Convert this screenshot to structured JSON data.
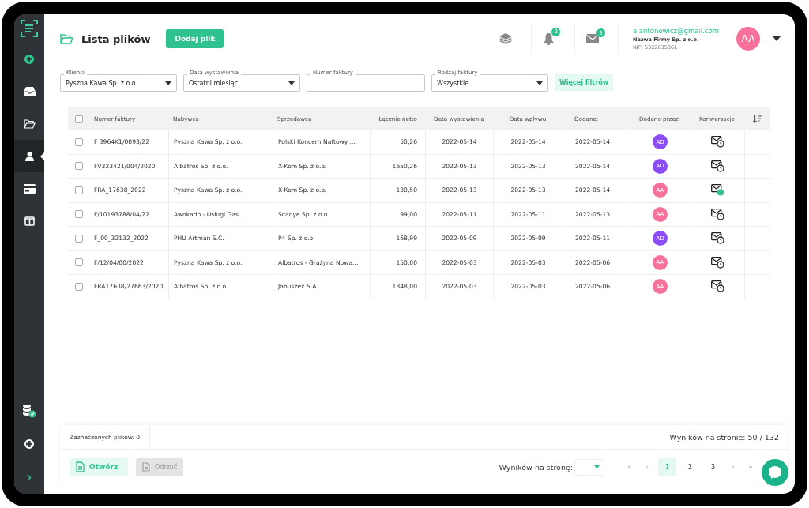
{
  "sidebar": {
    "items": [
      {
        "selected": false
      },
      {
        "selected": false
      },
      {
        "selected": false
      },
      {
        "selected": true
      },
      {
        "selected": false
      },
      {
        "selected": false
      }
    ]
  },
  "header": {
    "title": "Lista plików",
    "add_button": "Dodaj plik",
    "notifications_badge": "2",
    "messages_badge": "3",
    "user": {
      "email": "a.antonowicz@gmail.com",
      "company": "Nazwa Firmy Sp. z o.o.",
      "nip": "NIP: 5322635361",
      "initials": "AA"
    }
  },
  "filters": [
    {
      "kind": "select",
      "label": "Klienci",
      "value": "Pyszna Kawa Sp. z o.o."
    },
    {
      "kind": "select",
      "label": "Data wystawienia",
      "value": "Ostatni miesiąc"
    },
    {
      "kind": "text",
      "label": "Numer faktury"
    },
    {
      "kind": "select",
      "label": "Rodzaj faktury",
      "value": "Wszystkie"
    }
  ],
  "more_filters": "Więcej filtrów",
  "table": {
    "select_all_checked": false,
    "columns": [
      "Numer faktury",
      "Nabywca",
      "Sprzedawca",
      "Łącznie netto",
      "Data wystawienia",
      "Data wpływu",
      "Dodano:",
      "Dodano przez:",
      "Konwersacje"
    ],
    "rows": [
      {
        "checked": false,
        "number": "F 3964K1/0093/22",
        "buyer": "Pyszna Kawa Sp. z o.o.",
        "seller": "Polski Koncern Naftowy ...",
        "net": "50,26",
        "issued": "2022-05-14",
        "received": "2022-05-14",
        "added": "2022-05-14",
        "added_by": {
          "initials": "AD",
          "color": "#8b4cf6"
        },
        "conversation": {
          "kind": "pending"
        }
      },
      {
        "checked": false,
        "number": "FV323421/004/2020",
        "buyer": "Albatros Sp. z o.o.",
        "seller": "X-Kom Sp. z o.o.",
        "net": "1650,26",
        "issued": "2022-05-13",
        "received": "2022-05-13",
        "added": "2022-05-14",
        "added_by": {
          "initials": "AD",
          "color": "#8b4cf6"
        },
        "conversation": {
          "kind": "pending"
        }
      },
      {
        "checked": false,
        "number": "FRA_17638_2022",
        "buyer": "Pyszna Kawa Sp. z o.o.",
        "seller": "X-Kom Sp. z o.o.",
        "net": "130,50",
        "issued": "2022-05-13",
        "received": "2022-05-13",
        "added": "2022-05-14",
        "added_by": {
          "initials": "AA",
          "color": "#f7719a"
        },
        "conversation": {
          "kind": "new"
        }
      },
      {
        "checked": false,
        "number": "F/10193788/04/22",
        "buyer": "Awokado - Usługi Gas...",
        "seller": "Scanye Sp. z o.o.",
        "net": "99,00",
        "issued": "2022-05-11",
        "received": "2022-05-11",
        "added": "2022-05-13",
        "added_by": {
          "initials": "AA",
          "color": "#f7719a"
        },
        "conversation": {
          "kind": "pending"
        }
      },
      {
        "checked": false,
        "number": "F_00_32132_2022",
        "buyer": "PHU Artman S.C.",
        "seller": "P4 Sp. z o.o.",
        "net": "168,99",
        "issued": "2022-05-09",
        "received": "2022-05-09",
        "added": "2022-05-11",
        "added_by": {
          "initials": "AD",
          "color": "#8b4cf6"
        },
        "conversation": {
          "kind": "pending"
        }
      },
      {
        "checked": false,
        "number": "F/12/04/00/2022",
        "buyer": "Pyszna Kawa Sp. z o.o.",
        "seller": "Albatros - Grażyna Nowa...",
        "net": "150,00",
        "issued": "2022-05-03",
        "received": "2022-05-03",
        "added": "2022-05-06",
        "added_by": {
          "initials": "AA",
          "color": "#f7719a"
        },
        "conversation": {
          "kind": "pending"
        }
      },
      {
        "checked": false,
        "number": "FRA17638/27663/2020",
        "buyer": "Albatros Sp. z o.o.",
        "seller": "Januszex S.A.",
        "net": "1348,00",
        "issued": "2022-05-03",
        "received": "2022-05-03",
        "added": "2022-05-06",
        "added_by": {
          "initials": "AA",
          "color": "#f7719a"
        },
        "conversation": {
          "kind": "pending"
        }
      }
    ]
  },
  "footer": {
    "selected_count": "Zaznaczonych plików: 0",
    "results": "Wyników na stronie: 50 / 132",
    "open_button": {
      "label": "Otwórz",
      "disabled": false
    },
    "reject_button": {
      "label": "Odrzuć",
      "disabled": true
    },
    "per_page_label": "Wyników na stronę:",
    "pagination": [
      {
        "label": "«",
        "kind": "nav",
        "selected": false
      },
      {
        "label": "‹",
        "kind": "nav",
        "selected": false
      },
      {
        "label": "1",
        "kind": "page",
        "selected": true
      },
      {
        "label": "2",
        "kind": "page",
        "selected": false
      },
      {
        "label": "3",
        "kind": "page",
        "selected": false
      },
      {
        "label": "›",
        "kind": "nav",
        "selected": false
      },
      {
        "label": "»",
        "kind": "nav",
        "selected": false
      }
    ]
  }
}
